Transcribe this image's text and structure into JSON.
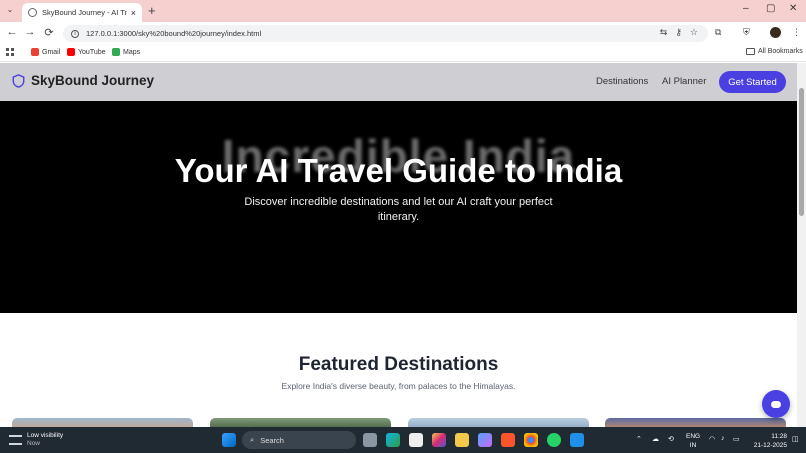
{
  "browser": {
    "tab_title": "SkyBound Journey - AI Travel G",
    "tab_close": "×",
    "new_tab": "+",
    "url": "127.0.0.1:3000/sky%20bound%20journey/index.html",
    "window_controls": {
      "minimize": "–",
      "maximize": "▢",
      "close": "✕"
    },
    "nav": {
      "back": "←",
      "forward": "→",
      "reload": "⟳"
    },
    "bookmarks": [
      {
        "label": "Gmail",
        "color": "#ea4335"
      },
      {
        "label": "YouTube",
        "color": "#ff0000"
      },
      {
        "label": "Maps",
        "color": "#34a853"
      }
    ],
    "all_bookmarks": "All Bookmarks"
  },
  "site": {
    "brand": "SkyBound Journey",
    "nav_links": [
      "Destinations",
      "AI Planner"
    ],
    "cta": "Get Started",
    "accent": "#4a3fe0",
    "hero": {
      "background_text": "Incredible India",
      "title": "Your AI Travel Guide to India",
      "subtitle": "Discover incredible destinations and let our AI craft your perfect itinerary."
    },
    "featured": {
      "title": "Featured Destinations",
      "subtitle": "Explore India's diverse beauty, from palaces to the Himalayas."
    }
  },
  "taskbar": {
    "weather_title": "Low visibility",
    "weather_sub": "Now",
    "search_placeholder": "Search",
    "lang_line1": "ENG",
    "lang_line2": "IN",
    "time": "11:28",
    "date": "21-12-2025"
  }
}
